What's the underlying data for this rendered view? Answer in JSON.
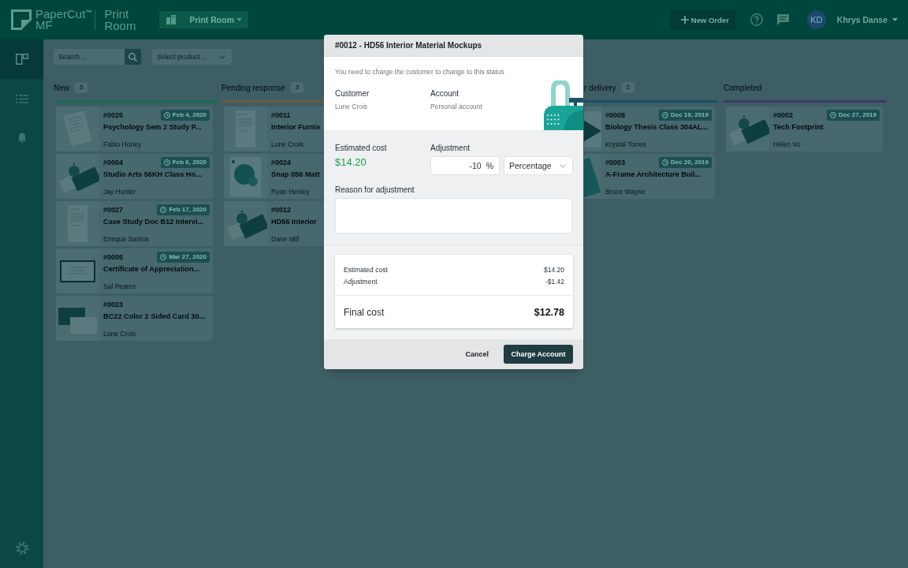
{
  "top_bar": {
    "logo": {
      "brand": "PaperCut$^{™}$",
      "edition": "MF",
      "product": "Print Room"
    },
    "workspace": {
      "label": "Print Room"
    },
    "new_order": {
      "label": "New Order"
    },
    "user": {
      "initials": "KD",
      "name": "Khrys Danse"
    }
  },
  "sidebar": {
    "items": [
      {
        "selected": true
      },
      {
        "selected": false
      },
      {
        "selected": false
      }
    ],
    "settings": {
      "selected": false
    }
  },
  "filters": {
    "search": {
      "placeholder": "Search ..."
    },
    "product": {
      "placeholder": "Select product ..."
    }
  },
  "board": {
    "columns": [
      {
        "title": "New",
        "count": "5",
        "color": "#1b6b56",
        "cards": [
          {
            "kind": "document",
            "number": "#0025",
            "date": "Feb 4, 2020",
            "title": "Psychology Sem 2 Study P...",
            "customer": "Fabio Honey"
          },
          {
            "kind": "mockup",
            "number": "#0004",
            "date": "Feb 6, 2020",
            "title": "Studio Arts 56KH Class Ho...",
            "customer": "Jay Hunter"
          },
          {
            "kind": "letter",
            "number": "#0027",
            "date": "Feb 17, 2020",
            "title": "Case Study Doc B12 Intervi...",
            "customer": "Enrique Santos"
          },
          {
            "kind": "certificate",
            "number": "#0005",
            "date": "Mar 27, 2020",
            "title": "Certificate of Appreciation...",
            "customer": "Sal Pearce"
          },
          {
            "kind": "businesscard",
            "number": "#0023",
            "title": "BC22 Color 2 Sided Card 30...",
            "customer": "Lune Crois"
          }
        ]
      },
      {
        "title": "Pending response",
        "count": "3",
        "color": "#6b5b3f",
        "cards": [
          {
            "kind": "letter",
            "number": "#0011",
            "title": "Interior Furnis",
            "customer": "Lune Crois"
          },
          {
            "kind": "poster",
            "number": "#0024",
            "title": "Snap 056 Matt",
            "customer": "Ryan Henley"
          },
          {
            "kind": "mockup",
            "number": "#0012",
            "title": "HD56 Interior",
            "customer": "Dane Mill"
          }
        ]
      },
      {
        "title": "r delivery",
        "count": "2",
        "color": "#1b4e6a",
        "cards": [
          {
            "kind": "booklet",
            "number": "#0008",
            "date": "Dec 19, 2019",
            "title": "Biology Thesis Class 304AL...",
            "customer": "Krystal Torres"
          },
          {
            "kind": "sign",
            "number": "#0003",
            "date": "Dec 20, 2019",
            "title": "A-Frame Architecture Buil...",
            "customer": "Bruce Wayne"
          }
        ]
      },
      {
        "title": "Completed",
        "color": "#3e3866",
        "cards": [
          {
            "kind": "mockup",
            "number": "#0002",
            "date": "Dec 27, 2019",
            "title": "Tech Footprint",
            "customer": "Helen Vo"
          }
        ]
      }
    ]
  },
  "dialog": {
    "title": "#0012 - HD56 Interior Material Mockups",
    "message": "You need to charge the customer to change to this status",
    "customer": {
      "label": "Customer",
      "value": "Lune Crois"
    },
    "account": {
      "label": "Account",
      "value": "Personal account"
    },
    "estimated_cost": {
      "label": "Estimated cost",
      "value": "$14.20"
    },
    "adjustment": {
      "label": "Adjustment",
      "value": "-10",
      "unit": "%",
      "type": "Percentage"
    },
    "reason": {
      "label": "Reason for adjustment"
    },
    "summary": {
      "rows": [
        {
          "label": "Estimated cost",
          "value": "$14.20"
        },
        {
          "label": "Adjustment",
          "value": "-$1.42"
        }
      ],
      "total": {
        "label": "Final cost",
        "value": "$12.78"
      }
    },
    "buttons": [
      {
        "label": "Cancel",
        "kind": "text"
      },
      {
        "label": "Charge Account",
        "kind": "primary"
      }
    ]
  }
}
